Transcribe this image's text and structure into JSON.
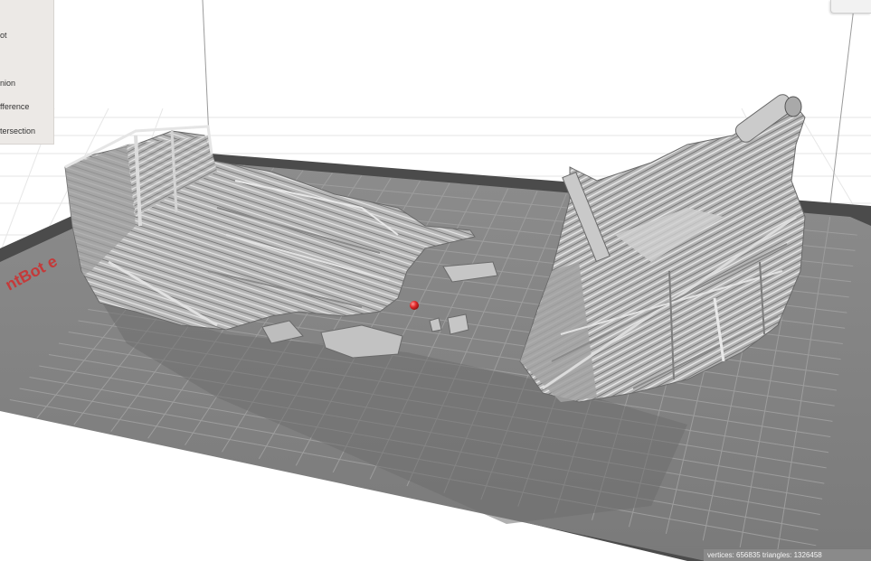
{
  "side_panel": {
    "items": [
      {
        "label": "ot"
      },
      {
        "label": "nion"
      },
      {
        "label": "fference"
      },
      {
        "label": "tersection"
      }
    ]
  },
  "plate": {
    "brand_text": "ntBot e",
    "model": "shipwreck",
    "colors": {
      "background": "#ffffff",
      "bed_edge": "#4a4a4a",
      "bed_surface": "#848484",
      "grid": "#9a9a9a",
      "model": "#b9b9b9",
      "model_shadow": "#6f6f6f",
      "marker": "#e02a2a"
    }
  },
  "status_bar": {
    "text": "vertices: 656835 triangles: 1326458"
  },
  "icons": {
    "view_cube": "view-cube-icon",
    "origin_marker": "origin-marker-icon"
  }
}
